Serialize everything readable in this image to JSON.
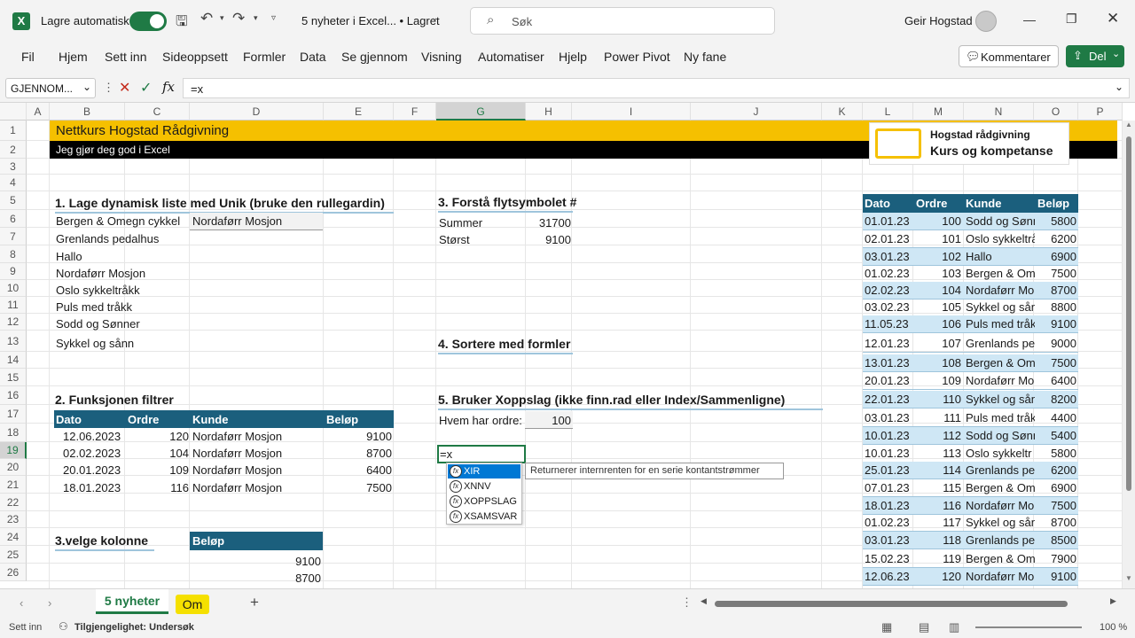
{
  "titlebar": {
    "autosave": "Lagre automatisk",
    "doc_title": "5 nyheter i Excel... • Lagret",
    "search_placeholder": "Søk",
    "user": "Geir Hogstad"
  },
  "menu": [
    "Fil",
    "Hjem",
    "Sett inn",
    "Sideoppsett",
    "Formler",
    "Data",
    "Se gjennom",
    "Visning",
    "Automatiser",
    "Hjelp",
    "Power Pivot",
    "Ny fane"
  ],
  "comments_btn": "Kommentarer",
  "share_btn": "Del",
  "formula_bar": {
    "name_box": "GJENNOM...",
    "formula": "=x"
  },
  "columns": [
    "A",
    "B",
    "C",
    "D",
    "E",
    "F",
    "G",
    "H",
    "I",
    "J",
    "K",
    "L",
    "M",
    "N",
    "O",
    "P"
  ],
  "rows": [
    "1",
    "2",
    "3",
    "4",
    "5",
    "6",
    "7",
    "8",
    "9",
    "10",
    "11",
    "12",
    "13",
    "14",
    "15",
    "16",
    "17",
    "18",
    "19",
    "20",
    "21",
    "22",
    "23",
    "24",
    "25",
    "26"
  ],
  "banner": {
    "title": "Nettkurs Hogstad Rådgivning",
    "subtitle": "Jeg gjør deg god i Excel"
  },
  "logo": {
    "line1": "Hogstad rådgivning",
    "line2": "Kurs og kompetanse"
  },
  "sec1": {
    "title": "1. Lage dynamisk liste med Unik (bruke den rullegardin)",
    "dropdown_value": "Nordaførr Mosjon",
    "list": [
      "Bergen & Omegn cykkel",
      "Grenlands pedalhus",
      "Hallo",
      "Nordaførr Mosjon",
      "Oslo sykkeltråkk",
      "Puls med tråkk",
      "Sodd og Sønner",
      "Sykkel og sånn"
    ]
  },
  "sec2": {
    "title": "2. Funksjonen filtrer",
    "headers": [
      "Dato",
      "Ordre",
      "Kunde",
      "Beløp"
    ],
    "rows": [
      [
        "12.06.2023",
        "120",
        "Nordaførr Mosjon",
        "9100"
      ],
      [
        "02.02.2023",
        "104",
        "Nordaførr Mosjon",
        "8700"
      ],
      [
        "20.01.2023",
        "109",
        "Nordaførr Mosjon",
        "6400"
      ],
      [
        "18.01.2023",
        "116",
        "Nordaførr Mosjon",
        "7500"
      ]
    ]
  },
  "sec3": {
    "title": "3. Forstå flytsymbolet #",
    "rows": [
      [
        "Summer",
        "31700"
      ],
      [
        "Størst",
        "9100"
      ]
    ]
  },
  "sec4": {
    "title": "4. Sortere med formler"
  },
  "sec5": {
    "title": "5. Bruker Xoppslag (ikke finn.rad eller Index/Sammenligne)",
    "label": "Hvem har ordre:",
    "value": "100",
    "editing": "=x"
  },
  "sec6": {
    "title": "3.velge kolonne",
    "header": "Beløp",
    "values": [
      "9100",
      "8700"
    ]
  },
  "autocomplete": {
    "items": [
      "XIR",
      "XNNV",
      "XOPPSLAG",
      "XSAMSVAR"
    ],
    "tooltip": "Returnerer internrenten for en serie kontantstrømmer"
  },
  "table": {
    "headers": [
      "Dato",
      "Ordre",
      "Kunde",
      "Beløp"
    ],
    "rows": [
      [
        "01.01.23",
        "100",
        "Sodd og Sønne",
        "5800"
      ],
      [
        "02.01.23",
        "101",
        "Oslo sykkeltrå",
        "6200"
      ],
      [
        "03.01.23",
        "102",
        "Hallo",
        "6900"
      ],
      [
        "01.02.23",
        "103",
        "Bergen & Om",
        "7500"
      ],
      [
        "02.02.23",
        "104",
        "Nordaførr Mo",
        "8700"
      ],
      [
        "03.02.23",
        "105",
        "Sykkel og sån",
        "8800"
      ],
      [
        "11.05.23",
        "106",
        "Puls med tråk",
        "9100"
      ],
      [
        "12.01.23",
        "107",
        "Grenlands pe",
        "9000"
      ],
      [
        "13.01.23",
        "108",
        "Bergen & Om",
        "7500"
      ],
      [
        "20.01.23",
        "109",
        "Nordaførr Mo",
        "6400"
      ],
      [
        "22.01.23",
        "110",
        "Sykkel og sån",
        "8200"
      ],
      [
        "03.01.23",
        "111",
        "Puls med tråk",
        "4400"
      ],
      [
        "10.01.23",
        "112",
        "Sodd og Sønn",
        "5400"
      ],
      [
        "10.01.23",
        "113",
        "Oslo sykkeltr",
        "5800"
      ],
      [
        "25.01.23",
        "114",
        "Grenlands pe",
        "6200"
      ],
      [
        "07.01.23",
        "115",
        "Bergen & Om",
        "6900"
      ],
      [
        "18.01.23",
        "116",
        "Nordaførr Mo",
        "7500"
      ],
      [
        "01.02.23",
        "117",
        "Sykkel og sån",
        "8700"
      ],
      [
        "03.01.23",
        "118",
        "Grenlands pe",
        "8500"
      ],
      [
        "15.02.23",
        "119",
        "Bergen & Om",
        "7900"
      ],
      [
        "12.06.23",
        "120",
        "Nordaførr Mo",
        "9100"
      ]
    ]
  },
  "tabs": {
    "active": "5 nyheter",
    "other": "Om"
  },
  "status": {
    "mode": "Sett inn",
    "accessibility": "Tilgjengelighet: Undersøk",
    "zoom": "100 %"
  },
  "colors": {
    "accent_green": "#1f7a45",
    "banner_yellow": "#f5c000",
    "header_blue": "#1b5f7d",
    "row_blue": "#cfe7f5"
  }
}
